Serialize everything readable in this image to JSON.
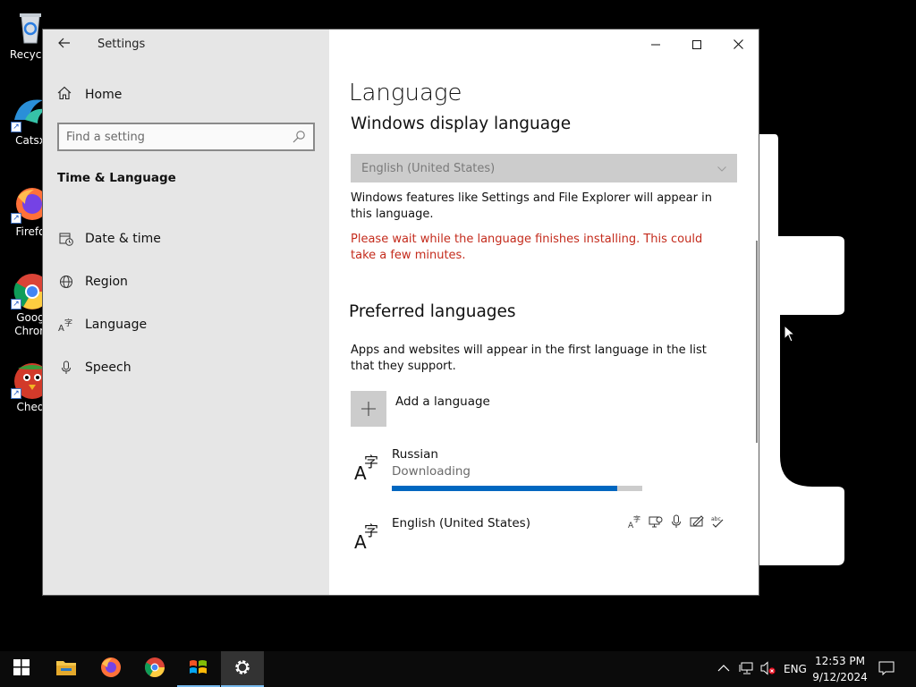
{
  "desktop": {
    "icons": [
      {
        "label": "Recycle",
        "icon": "recycle-bin-icon"
      },
      {
        "label": "Catsx",
        "icon": "app-icon"
      },
      {
        "label": "Firefo",
        "icon": "firefox-icon"
      },
      {
        "label": "Goog Chron",
        "icon": "chrome-icon"
      },
      {
        "label": "Ched",
        "icon": "bird-icon"
      }
    ]
  },
  "window": {
    "title": "Settings",
    "controls": {
      "minimize": "minimize-icon",
      "maximize": "maximize-icon",
      "close": "close-icon"
    }
  },
  "sidebar": {
    "home_label": "Home",
    "search_placeholder": "Find a setting",
    "section_title": "Time & Language",
    "items": [
      {
        "label": "Date & time",
        "icon": "calendar-clock-icon"
      },
      {
        "label": "Region",
        "icon": "globe-icon"
      },
      {
        "label": "Language",
        "icon": "language-icon"
      },
      {
        "label": "Speech",
        "icon": "microphone-icon"
      }
    ]
  },
  "content": {
    "page_title": "Language",
    "display_language": {
      "heading": "Windows display language",
      "selected": "English (United States)",
      "description": "Windows features like Settings and File Explorer will appear in this language.",
      "warning": "Please wait while the language finishes installing. This could take a few minutes."
    },
    "preferred": {
      "heading": "Preferred languages",
      "description": "Apps and websites will appear in the first language in the list that they support.",
      "add_label": "Add a language",
      "languages": [
        {
          "name": "Russian",
          "status": "Downloading",
          "progress": 0.9
        },
        {
          "name": "English (United States)",
          "features": [
            "display-language-icon",
            "text-to-speech-icon",
            "speech-recognition-icon",
            "handwriting-icon",
            "spell-check-icon"
          ]
        }
      ]
    }
  },
  "taskbar": {
    "apps": [
      "start-icon",
      "file-explorer-icon",
      "firefox-icon",
      "chrome-icon",
      "windows-flag-icon",
      "settings-icon"
    ],
    "tray": {
      "language": "ENG",
      "time": "12:53 PM",
      "date": "9/12/2024"
    }
  },
  "colors": {
    "accent": "#0067c0",
    "warning": "#c42b1c",
    "sidebar_bg": "#e6e6e6"
  }
}
